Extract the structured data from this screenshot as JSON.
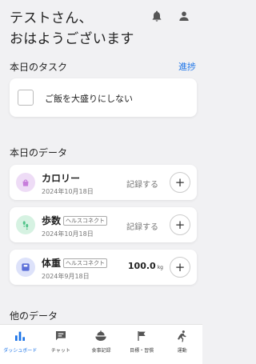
{
  "header": {
    "greeting_line1": "テストさん、",
    "greeting_line2": "おはようございます"
  },
  "tasks": {
    "title": "本日のタスク",
    "progress_link": "進捗",
    "items": [
      {
        "label": "ご飯を大盛りにしない",
        "checked": false
      }
    ]
  },
  "data_section": {
    "title": "本日のデータ",
    "cards": [
      {
        "name": "カロリー",
        "date": "2024年10月18日",
        "action": "記録する",
        "icon": "calorie-icon",
        "color": "#c77ddb"
      },
      {
        "name": "歩数",
        "source": "ヘルスコネクト",
        "date": "2024年10月18日",
        "action": "記録する",
        "icon": "footsteps-icon",
        "color": "#52c48a"
      },
      {
        "name": "体重",
        "source": "ヘルスコネクト",
        "date": "2024年9月18日",
        "value": "100.0",
        "unit": "kg",
        "icon": "scale-icon",
        "color": "#5b6fd8"
      }
    ],
    "plus": "+"
  },
  "other_section": {
    "title": "他のデータ"
  },
  "tabbar": {
    "tabs": [
      {
        "label": "ダッシュボード",
        "icon": "bar-chart-icon",
        "active": true
      },
      {
        "label": "チャット",
        "icon": "chat-icon",
        "active": false
      },
      {
        "label": "食事記録",
        "icon": "meal-icon",
        "active": false
      },
      {
        "label": "目標・習慣",
        "icon": "flag-icon",
        "active": false
      },
      {
        "label": "運動",
        "icon": "run-icon",
        "active": false
      }
    ]
  },
  "colors": {
    "accent": "#1a73e8",
    "background": "#f1f1f3"
  }
}
